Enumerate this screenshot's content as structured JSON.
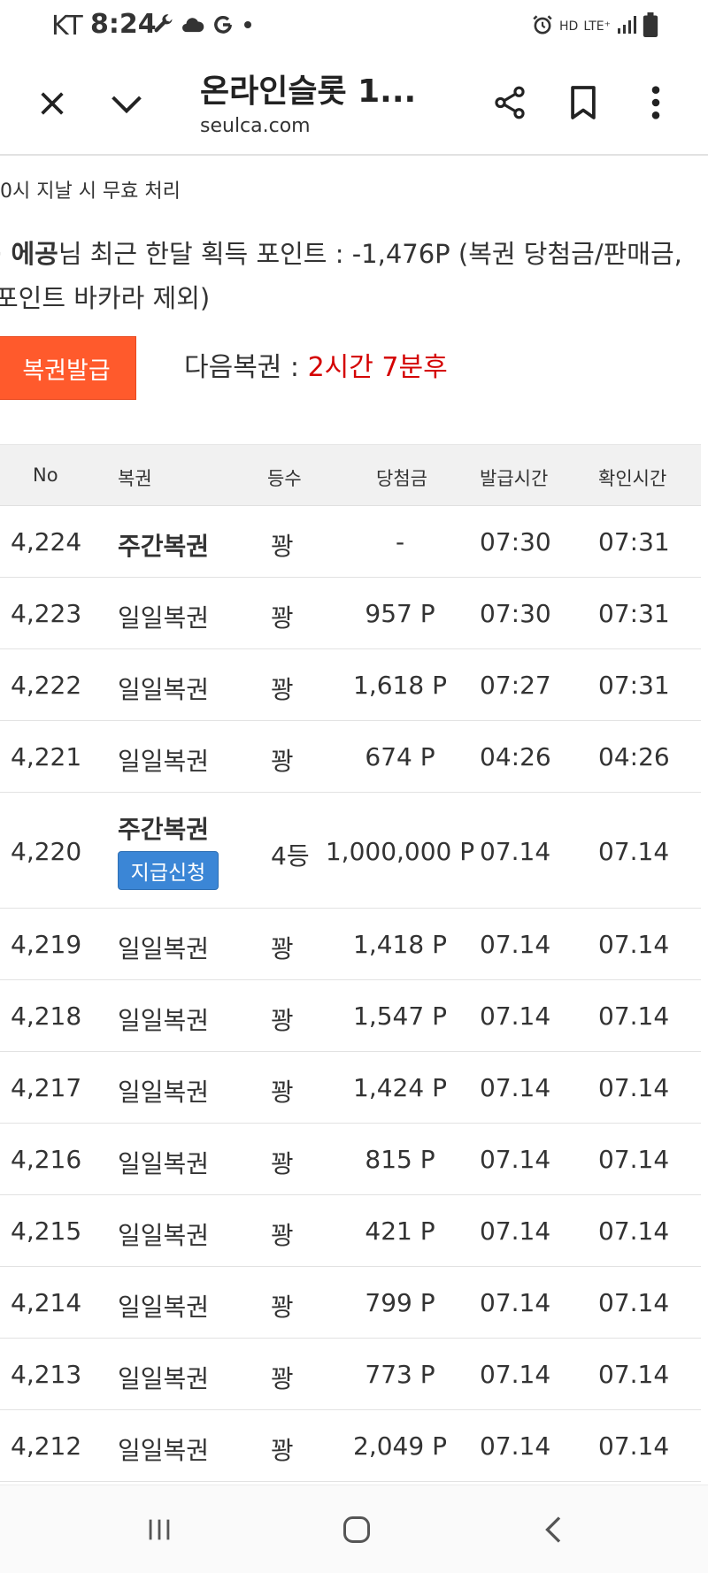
{
  "status_bar": {
    "carrier": "KT",
    "time": "8:24",
    "hd": "HD",
    "lte": "LTE⁺"
  },
  "browser": {
    "title": "온라인슬롯 1...",
    "domain": "seulca.com"
  },
  "content": {
    "notice_top": "0시 지날 시 무효 처리",
    "points": {
      "bullet": "·",
      "user": "에공",
      "text": "님 최근 한달 획득 포인트 : -1,476P (복권 당첨금/판매금, 포인트 바카라 제외)"
    },
    "issue_button": "복권발급",
    "next_label": "다음복권 : ",
    "next_value": "2시간 7분후"
  },
  "table": {
    "headers": [
      "No",
      "복권",
      "등수",
      "당첨금",
      "발급시간",
      "확인시간"
    ],
    "rows": [
      {
        "no": "4,224",
        "type": "주간복권",
        "grade": "꽝",
        "prize": "-",
        "issued": "07:30",
        "confirmed": "07:31"
      },
      {
        "no": "4,223",
        "type": "일일복권",
        "grade": "꽝",
        "prize": "957 P",
        "issued": "07:30",
        "confirmed": "07:31"
      },
      {
        "no": "4,222",
        "type": "일일복권",
        "grade": "꽝",
        "prize": "1,618 P",
        "issued": "07:27",
        "confirmed": "07:31"
      },
      {
        "no": "4,221",
        "type": "일일복권",
        "grade": "꽝",
        "prize": "674 P",
        "issued": "04:26",
        "confirmed": "04:26"
      },
      {
        "no": "4,220",
        "type": "주간복권",
        "grade": "4등",
        "prize": "1,000,000 P",
        "issued": "07.14",
        "confirmed": "07.14",
        "claim": "지급신청"
      },
      {
        "no": "4,219",
        "type": "일일복권",
        "grade": "꽝",
        "prize": "1,418 P",
        "issued": "07.14",
        "confirmed": "07.14"
      },
      {
        "no": "4,218",
        "type": "일일복권",
        "grade": "꽝",
        "prize": "1,547 P",
        "issued": "07.14",
        "confirmed": "07.14"
      },
      {
        "no": "4,217",
        "type": "일일복권",
        "grade": "꽝",
        "prize": "1,424 P",
        "issued": "07.14",
        "confirmed": "07.14"
      },
      {
        "no": "4,216",
        "type": "일일복권",
        "grade": "꽝",
        "prize": "815 P",
        "issued": "07.14",
        "confirmed": "07.14"
      },
      {
        "no": "4,215",
        "type": "일일복권",
        "grade": "꽝",
        "prize": "421 P",
        "issued": "07.14",
        "confirmed": "07.14"
      },
      {
        "no": "4,214",
        "type": "일일복권",
        "grade": "꽝",
        "prize": "799 P",
        "issued": "07.14",
        "confirmed": "07.14"
      },
      {
        "no": "4,213",
        "type": "일일복권",
        "grade": "꽝",
        "prize": "773 P",
        "issued": "07.14",
        "confirmed": "07.14"
      },
      {
        "no": "4,212",
        "type": "일일복권",
        "grade": "꽝",
        "prize": "2,049 P",
        "issued": "07.14",
        "confirmed": "07.14"
      }
    ]
  },
  "icons": {
    "status_left": [
      "wrench-icon",
      "cloud-icon",
      "g-icon",
      "dot-icon"
    ],
    "status_right": [
      "alarm-icon",
      "signal-icon",
      "battery-icon"
    ],
    "browser": [
      "close-icon",
      "chevron-down-icon",
      "share-icon",
      "bookmark-icon",
      "more-vert-icon"
    ],
    "nav": [
      "recents-icon",
      "home-icon",
      "back-icon"
    ]
  },
  "colors": {
    "issue_button": "#ff5a2c",
    "next_value": "#d40000",
    "claim_button": "#3b86d6"
  }
}
